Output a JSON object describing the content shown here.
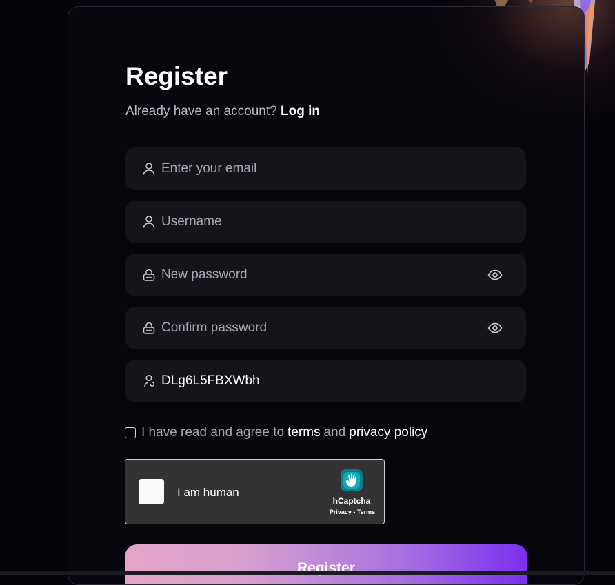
{
  "form": {
    "title": "Register",
    "subtitle_prefix": "Already have an account?",
    "login_link": "Log in",
    "fields": {
      "email": {
        "placeholder": "Enter your email",
        "icon": "user-icon"
      },
      "username": {
        "placeholder": "Username",
        "icon": "user-icon"
      },
      "new_password": {
        "placeholder": "New password",
        "icon": "lock-icon",
        "toggle_icon": "eye-icon"
      },
      "confirm_password": {
        "placeholder": "Confirm password",
        "icon": "lock-icon",
        "toggle_icon": "eye-icon"
      },
      "referral_code": {
        "value": "DLg6L5FBXWbh",
        "icon": "user-refresh-icon"
      }
    },
    "agree": {
      "text": "I have read and agree to",
      "terms_link": "terms",
      "joiner": "and",
      "privacy_link": "privacy policy"
    },
    "captcha": {
      "label": "I am human",
      "brand": "hCaptcha",
      "links": "Privacy - Terms"
    },
    "submit_label": "Register"
  },
  "colors": {
    "background": "#050309",
    "field_bg": "#15141b",
    "button_gradient_start": "#e4a6c6",
    "button_gradient_end": "#7b2ff0"
  }
}
